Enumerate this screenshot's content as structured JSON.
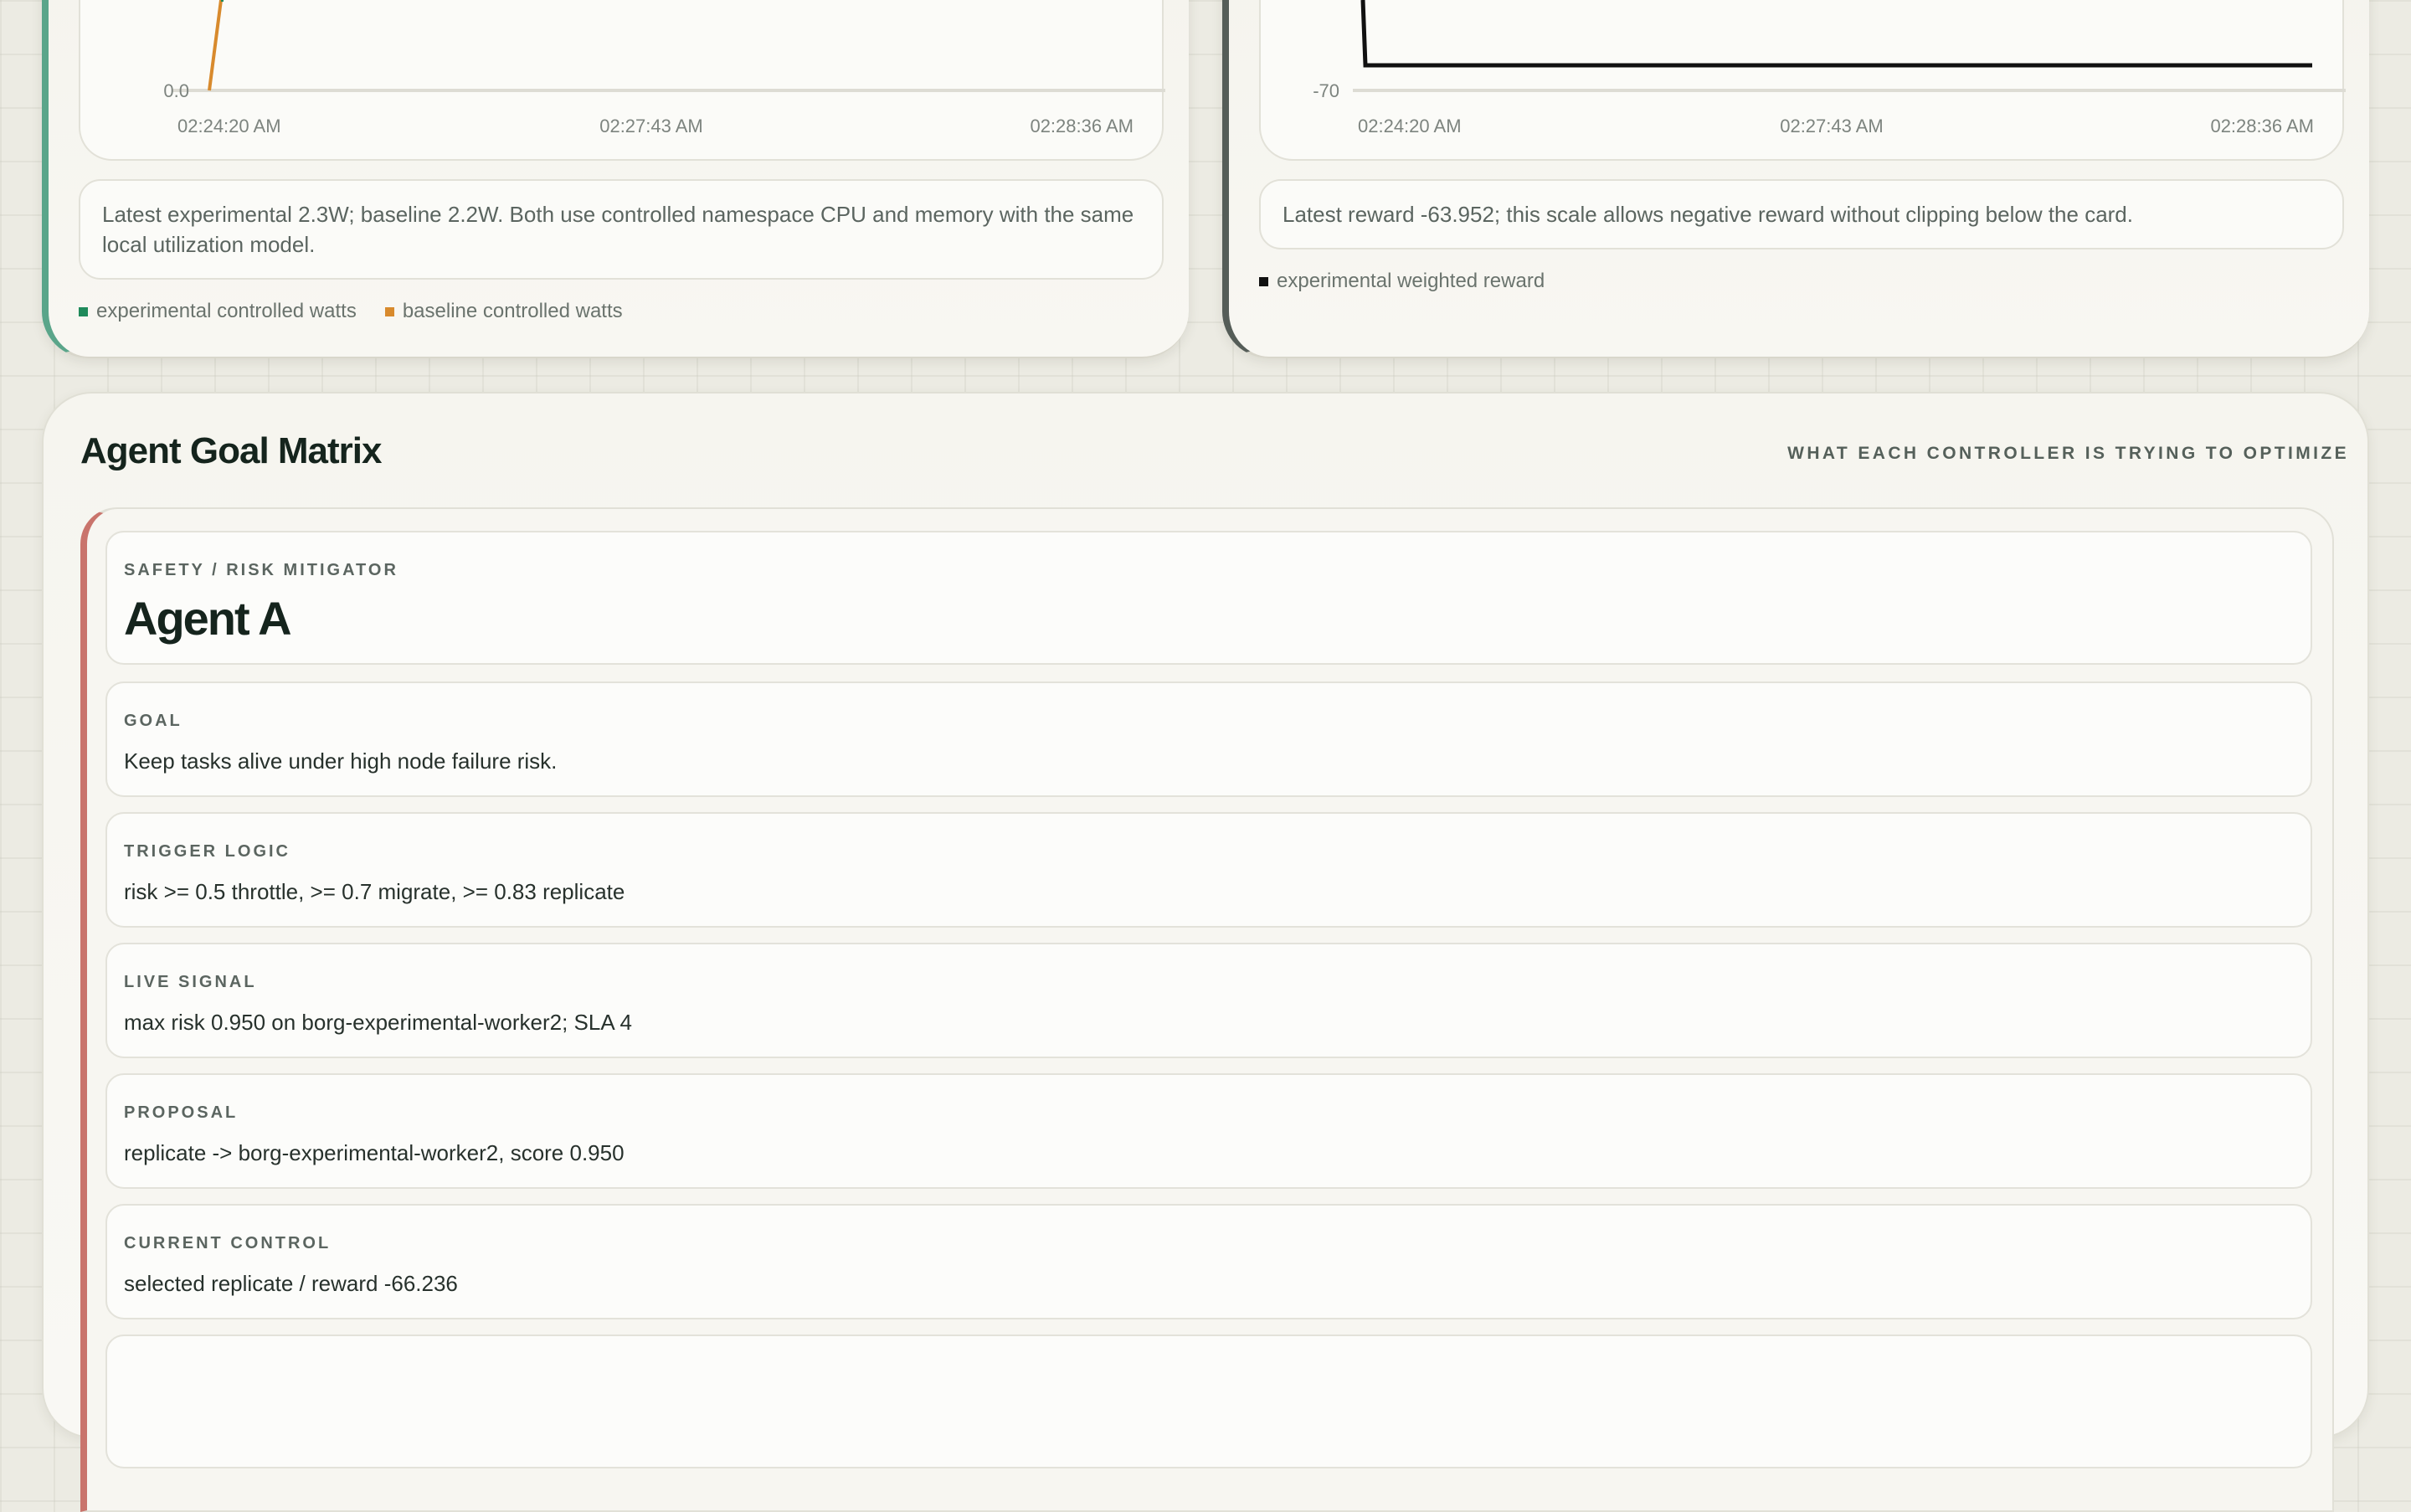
{
  "power_panel": {
    "chart_data": {
      "type": "line",
      "x_ticks": [
        "02:24:20 AM",
        "02:27:43 AM",
        "02:28:36 AM"
      ],
      "y_ticks_visible": [
        "0.0"
      ],
      "series": [
        {
          "name": "experimental controlled watts",
          "color": "#1f8a5b"
        },
        {
          "name": "baseline controlled watts",
          "color": "#d88a2d"
        }
      ]
    },
    "note": "Latest experimental 2.3W; baseline 2.2W. Both use controlled namespace CPU and memory with the same local utilization model.",
    "legend": [
      {
        "label": "experimental controlled watts",
        "color": "#1f8a5b"
      },
      {
        "label": "baseline controlled watts",
        "color": "#d88a2d"
      }
    ]
  },
  "reward_panel": {
    "chart_data": {
      "type": "line",
      "x_ticks": [
        "02:24:20 AM",
        "02:27:43 AM",
        "02:28:36 AM"
      ],
      "y_ticks_visible": [
        "-70"
      ],
      "series": [
        {
          "name": "experimental weighted reward",
          "color": "#111111"
        }
      ]
    },
    "note": "Latest reward -63.952; this scale allows negative reward without clipping below the card.",
    "legend": [
      {
        "label": "experimental weighted reward",
        "color": "#111111"
      }
    ]
  },
  "goal_matrix": {
    "title": "Agent Goal Matrix",
    "subtitle": "WHAT EACH CONTROLLER IS TRYING TO OPTIMIZE",
    "agent": {
      "role": "SAFETY / RISK MITIGATOR",
      "name": "Agent A",
      "accent": "#c9746c",
      "fields": [
        {
          "label": "GOAL",
          "value": "Keep tasks alive under high node failure risk."
        },
        {
          "label": "TRIGGER LOGIC",
          "value": "risk >= 0.5 throttle, >= 0.7 migrate, >= 0.83 replicate"
        },
        {
          "label": "LIVE SIGNAL",
          "value": "max risk 0.950 on borg-experimental-worker2; SLA 4"
        },
        {
          "label": "PROPOSAL",
          "value": "replicate -> borg-experimental-worker2, score 0.950"
        },
        {
          "label": "CURRENT CONTROL",
          "value": "selected replicate / reward -66.236"
        }
      ]
    }
  }
}
